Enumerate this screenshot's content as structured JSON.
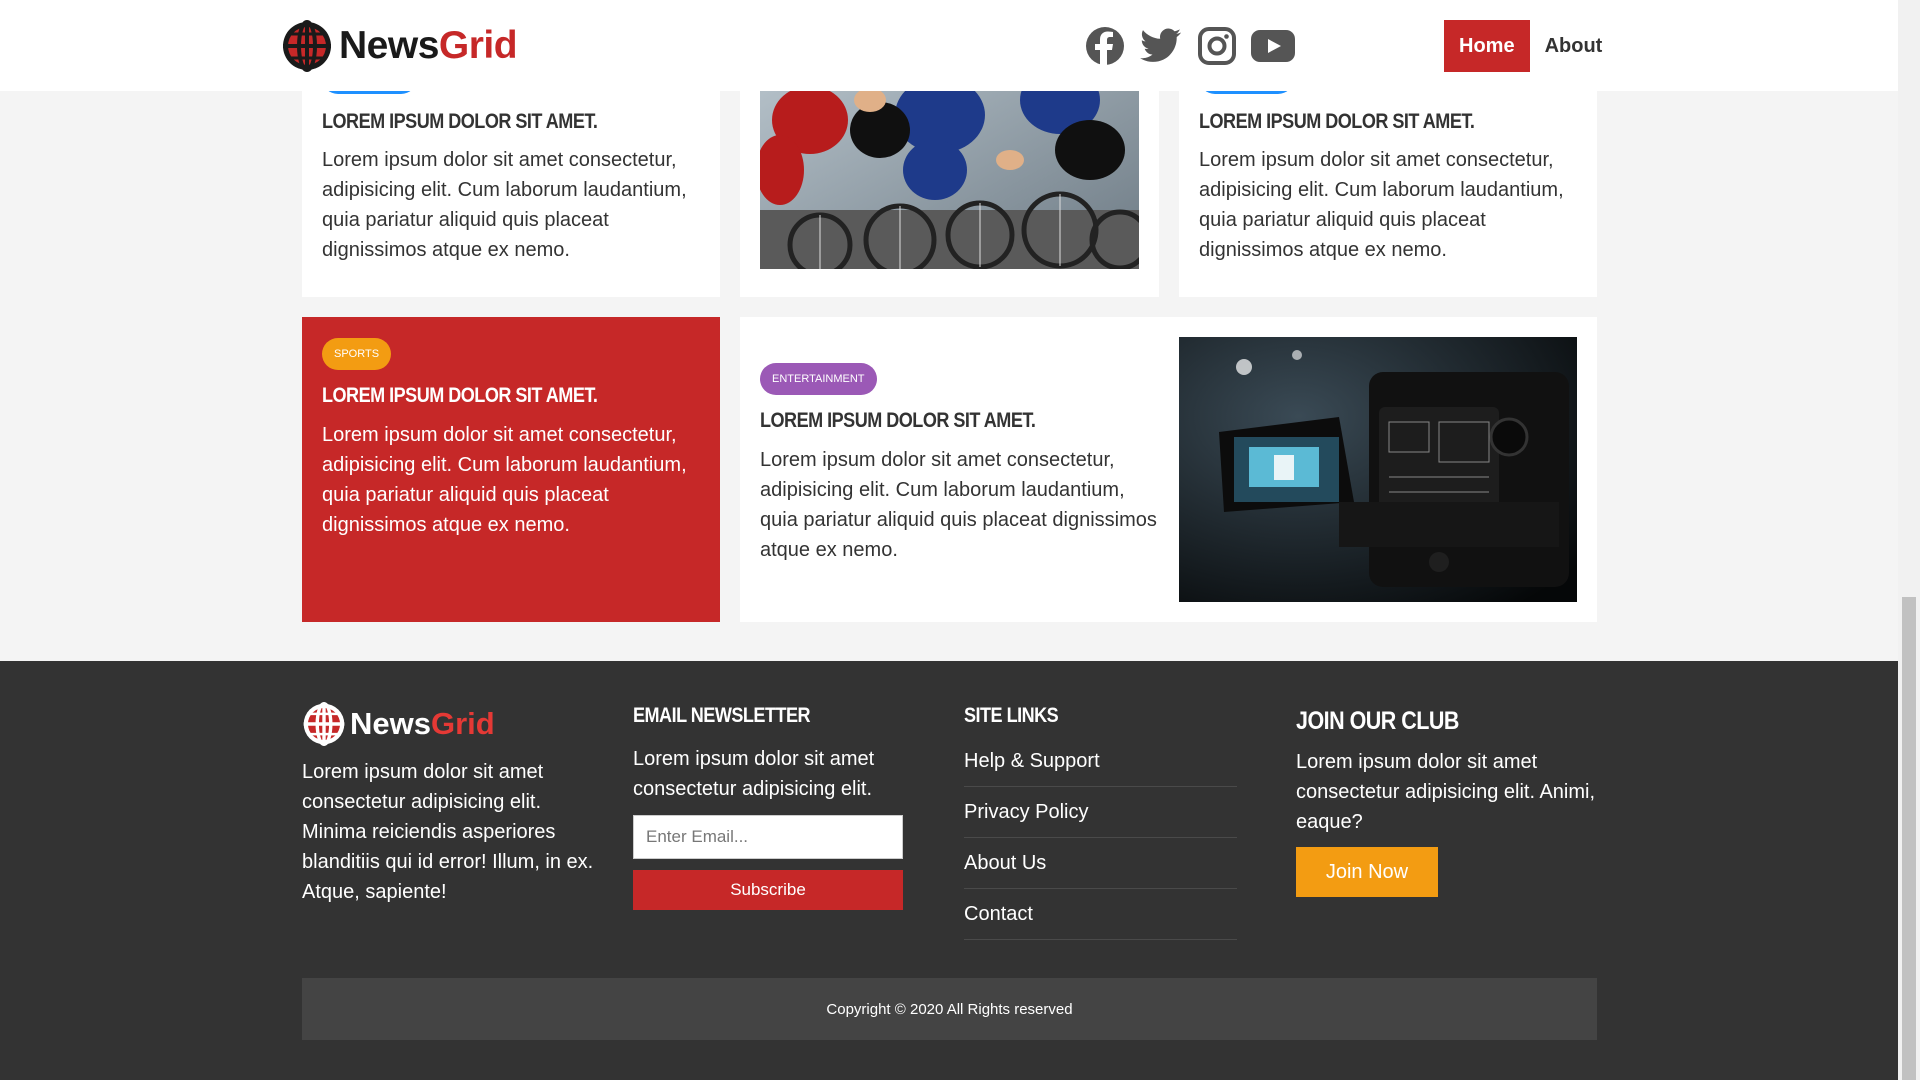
{
  "brand": {
    "name_part1": "News",
    "name_part2": "Grid"
  },
  "header": {
    "social": [
      {
        "icon": "facebook-icon"
      },
      {
        "icon": "twitter-icon"
      },
      {
        "icon": "instagram-icon"
      },
      {
        "icon": "youtube-icon"
      }
    ],
    "nav": [
      {
        "label": "Home",
        "active": true
      },
      {
        "label": "About",
        "active": false
      }
    ]
  },
  "cards": {
    "top_left": {
      "title": "Lorem ipsum dolor sit amet.",
      "text": "Lorem ipsum dolor sit amet consectetur, adipisicing elit. Cum laborum laudantium, quia pariatur aliquid quis placeat dignissimos atque ex nemo."
    },
    "top_middle": {
      "image": "cycling-race-photo"
    },
    "top_right": {
      "title": "Lorem ipsum dolor sit amet.",
      "text": "Lorem ipsum dolor sit amet consectetur, adipisicing elit. Cum laborum laudantium, quia pariatur aliquid quis placeat dignissimos atque ex nemo."
    },
    "sports": {
      "badge": "Sports",
      "badge_color": "#f39c12",
      "title": "Lorem ipsum dolor sit amet.",
      "text": "Lorem ipsum dolor sit amet consectetur, adipisicing elit. Cum laborum laudantium, quia pariatur aliquid quis placeat dignissimos atque ex nemo."
    },
    "entertainment": {
      "badge": "Entertainment",
      "badge_color": "#9b59b6",
      "title": "Lorem ipsum dolor sit amet.",
      "text": "Lorem ipsum dolor sit amet consectetur, adipisicing elit. Cum laborum laudantium, quia pariatur aliquid quis placeat dignissimos atque ex nemo.",
      "image": "video-camera-photo"
    }
  },
  "footer": {
    "about_text": "Lorem ipsum dolor sit amet consectetur adipisicing elit. Minima reiciendis asperiores blanditiis qui id error! Illum, in ex. Atque, sapiente!",
    "newsletter": {
      "heading": "Email Newsletter",
      "text": "Lorem ipsum dolor sit amet consectetur adipisicing elit.",
      "placeholder": "Enter Email...",
      "button": "Subscribe"
    },
    "site_links": {
      "heading": "Site Links",
      "links": [
        "Help & Support",
        "Privacy Policy",
        "About Us",
        "Contact"
      ]
    },
    "club": {
      "heading": "Join Our Club",
      "text": "Lorem ipsum dolor sit amet consectetur adipisicing elit. Animi, eaque?",
      "button": "Join Now"
    },
    "copyright": "Copyright © 2020 All Rights reserved"
  },
  "colors": {
    "primary_red": "#c62828",
    "footer_bg": "#333333",
    "orange": "#f39c12",
    "purple": "#9b59b6",
    "blue_badge": "#1e90ff"
  }
}
